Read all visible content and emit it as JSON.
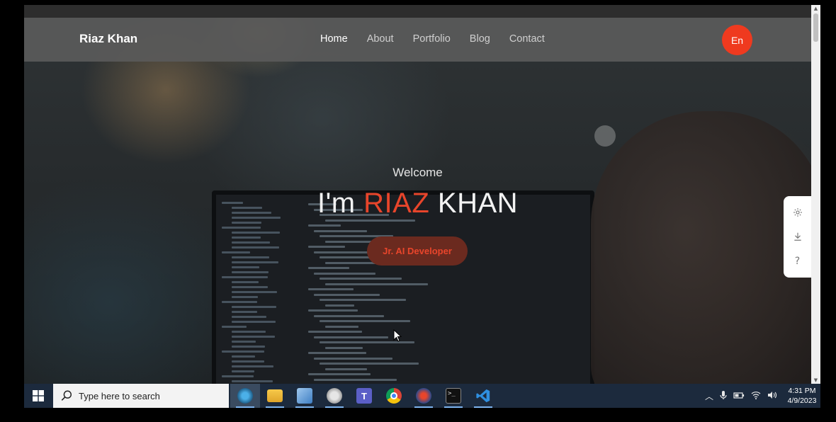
{
  "navbar": {
    "brand": "Riaz Khan",
    "links": [
      "Home",
      "About",
      "Portfolio",
      "Blog",
      "Contact"
    ],
    "active_link": "Home",
    "lang_button": "En"
  },
  "hero": {
    "welcome": "Welcome",
    "title_prefix": "I'm ",
    "title_accent": "RIAZ",
    "title_suffix": " KHAN",
    "cta_label": "Jr. AI Developer"
  },
  "side_panel": {
    "icons": [
      "gear-icon",
      "download-icon",
      "help-icon"
    ]
  },
  "taskbar": {
    "search_placeholder": "Type here to search",
    "apps": [
      "cortana",
      "file-explorer",
      "app-3",
      "app-4",
      "teams",
      "chrome",
      "app-7",
      "terminal",
      "vscode"
    ],
    "clock_time": "4:31 PM",
    "clock_date": "4/9/2023"
  },
  "colors": {
    "accent": "#e8452b",
    "lang_button": "#ef3a1f",
    "navbar": "#5a5a5a",
    "taskbar": "#1c2a3d"
  }
}
